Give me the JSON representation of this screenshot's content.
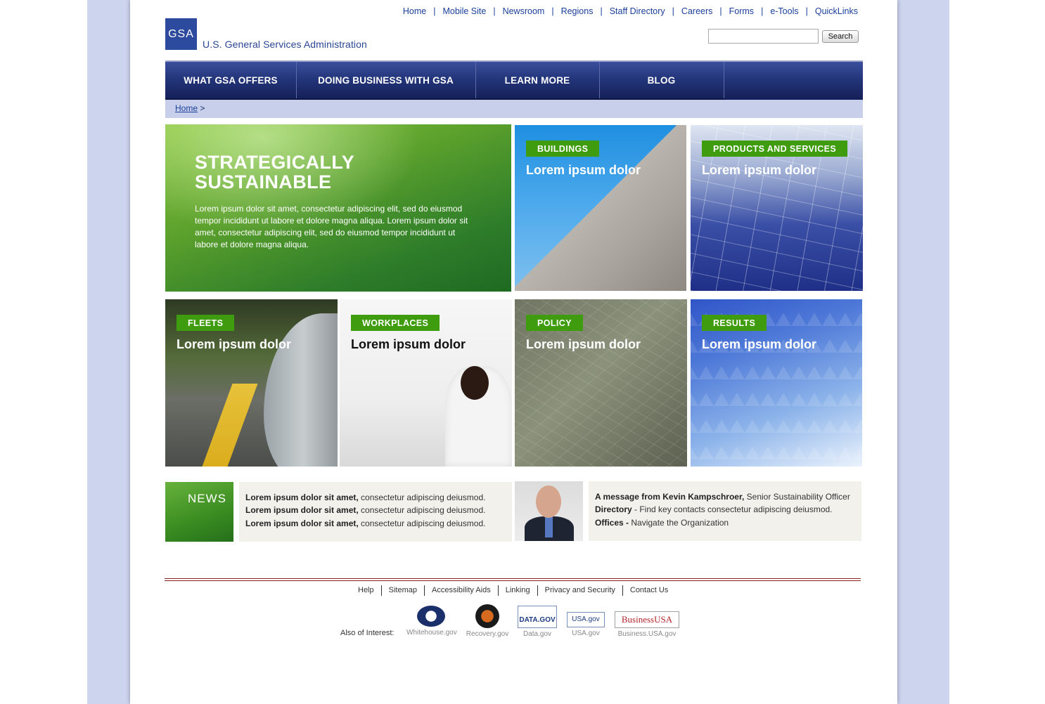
{
  "utility_nav": [
    "Home",
    "Mobile Site",
    "Newsroom",
    "Regions",
    "Staff Directory",
    "Careers",
    "Forms",
    "e-Tools",
    "QuickLinks"
  ],
  "utility_sep": "|",
  "logo": {
    "mark": "GSA",
    "name": "U.S. General Services Administration"
  },
  "search": {
    "value": "",
    "button": "Search"
  },
  "main_nav": [
    "WHAT GSA OFFERS",
    "DOING BUSINESS WITH GSA",
    "LEARN MORE",
    "BLOG"
  ],
  "breadcrumb": {
    "home": "Home",
    "sep": ">"
  },
  "hero": {
    "title_line1": "STRATEGICALLY",
    "title_line2": "SUSTAINABLE",
    "text": "Lorem ipsum dolor sit amet, consectetur adipiscing elit, sed do eiusmod tempor incididunt ut labore et dolore magna aliqua. Lorem ipsum dolor sit amet, consectetur adipiscing elit, sed do eiusmod tempor incididunt ut labore et dolore magna aliqua."
  },
  "tiles": [
    {
      "tag": "BUILDINGS",
      "title": "Lorem ipsum dolor"
    },
    {
      "tag": "PRODUCTS AND SERVICES",
      "title": "Lorem ipsum dolor"
    },
    {
      "tag": "FLEETS",
      "title": "Lorem ipsum dolor"
    },
    {
      "tag": "WORKPLACES",
      "title": "Lorem ipsum dolor"
    },
    {
      "tag": "POLICY",
      "title": "Lorem ipsum dolor"
    },
    {
      "tag": "RESULTS",
      "title": "Lorem ipsum dolor"
    }
  ],
  "news": {
    "label": "NEWS",
    "items": [
      {
        "bold": "Lorem ipsum dolor sit amet,",
        "text": " consectetur adipiscing deiusmod."
      },
      {
        "bold": "Lorem ipsum dolor sit amet,",
        "text": " consectetur adipiscing deiusmod."
      },
      {
        "bold": "Lorem ipsum dolor sit amet,",
        "text": " consectetur adipiscing deiusmod."
      }
    ]
  },
  "message": {
    "line1_bold": "A message from Kevin Kampschroer,",
    "line1_text": " Senior Sustainability Officer",
    "line2_bold": "Directory",
    "line2_text": "  - Find key contacts consectetur adipiscing deiusmod.",
    "line3_bold": "Offices -",
    "line3_text": " Navigate the Organization"
  },
  "footer_links": [
    "Help",
    "Sitemap",
    "Accessibility Aids",
    "Linking",
    "Privacy and Security",
    "Contact Us"
  ],
  "also_of_interest": {
    "label": "Also of Interest:",
    "sites": [
      "Whitehouse.gov",
      "Recovery.gov",
      "Data.gov",
      "USA.gov",
      "Business.USA.gov"
    ],
    "badge_texts": [
      "DATA.GOV",
      "USA.gov",
      "BusinessUSA"
    ]
  },
  "colors": {
    "nav_blue": "#23357a",
    "tag_green": "#3f9c0f",
    "link_blue": "#1a3f9a",
    "page_bg": "#cdd4ee"
  }
}
